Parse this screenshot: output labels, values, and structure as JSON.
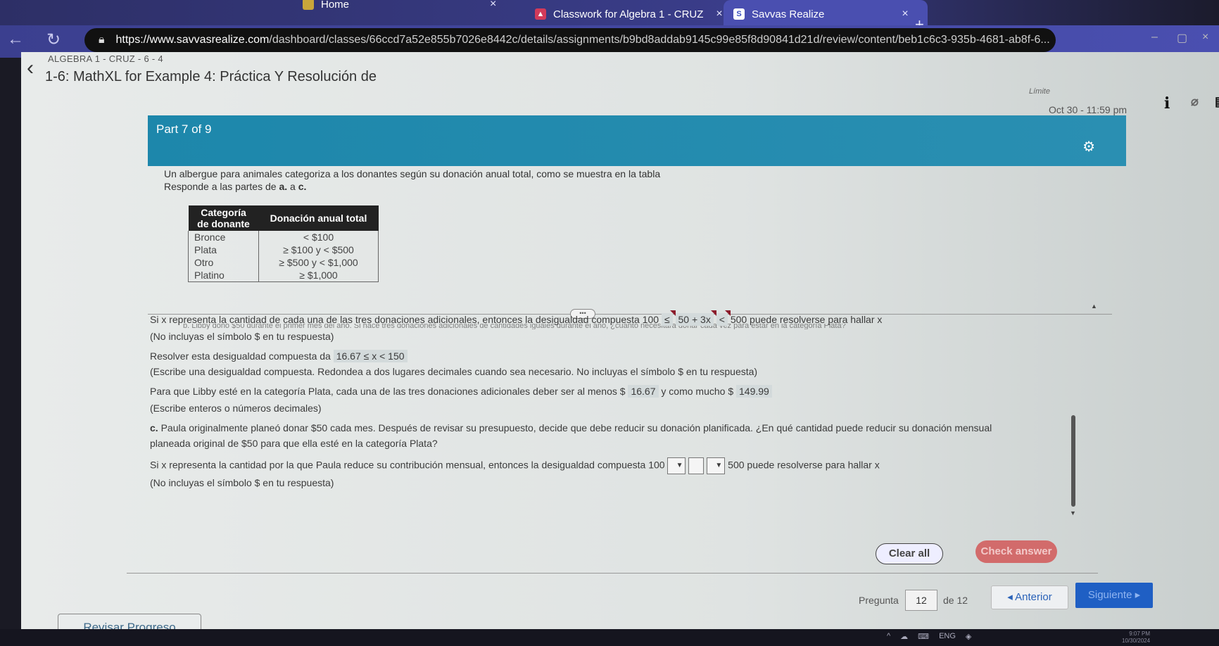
{
  "browser": {
    "tabs": [
      {
        "label": "Home",
        "icon": "home-tab-icon"
      },
      {
        "label": "Classwork for Algebra 1 - CRUZ",
        "icon": "classroom-icon"
      },
      {
        "label": "Savvas Realize",
        "icon": "savvas-icon",
        "active": true
      }
    ],
    "new_tab": "+",
    "close": "×",
    "url_host": "https://www.savvasrealize.com",
    "url_path": "/dashboard/classes/66ccd7a52e855b7026e8442c/details/assignments/b9bd8addab9145c99e85f8d90841d21d/review/content/beb1c6c3-935b-4681-ab8f-6...",
    "window_controls": {
      "minimize": "–",
      "restore": "▢",
      "close": "×"
    }
  },
  "header": {
    "breadcrumb": "ALGEBRA 1 - CRUZ - 6 - 4",
    "title": "1-6: MathXL for Example 4: Práctica Y Resolución de",
    "limit_label": "Límite",
    "limit_value": "Oct 30 - 11:59 pm",
    "icons": [
      "info-icon",
      "attachment-icon",
      "comment-icon"
    ]
  },
  "question": {
    "part_label": "Part 7 of 9",
    "intro_line1": "Un albergue para animales categoriza a los donantes según su donación anual total, como se muestra en la tabla",
    "intro_line2_prefix": "Responde a las partes de ",
    "intro_a": "a.",
    "intro_mid": " a ",
    "intro_c": "c.",
    "table": {
      "headers": [
        "Categoría de donante",
        "Donación anual total"
      ],
      "rows": [
        [
          "Bronce",
          "< $100"
        ],
        [
          "Plata",
          "≥ $100 y < $500"
        ],
        [
          "Otro",
          "≥ $500 y < $1,000"
        ],
        [
          "Platino",
          "≥ $1,000"
        ]
      ]
    },
    "handle": "•••",
    "cut_line": "b. Libby donó $50 durante el primer mes del año. Si hace tres donaciones adicionales de cantidades iguales durante el año, ¿cuánto necesitará donar cada vez para estar en la categoría Plata?",
    "b1_text": "Si x representa la cantidad de cada una de las tres donaciones adicionales, entonces la desigualdad compuesta 100",
    "b1_op1": "≤",
    "b1_expr": "50 + 3x",
    "b1_op2": "<",
    "b1_tail": "500 puede resolverse para hallar x",
    "b1_note": "(No incluyas el símbolo $ en tu respuesta)",
    "b2_text": "Resolver esta desigualdad compuesta da",
    "b2_answer": "16.67 ≤ x < 150",
    "b2_note": "(Escribe una desigualdad compuesta. Redondea a dos lugares decimales cuando sea necesario. No incluyas el símbolo $ en tu respuesta)",
    "b3_text": "Para que Libby esté en la categoría Plata, cada una de las tres donaciones adicionales deber ser al menos $",
    "b3_min": "16.67",
    "b3_mid": "y como mucho $",
    "b3_max": "149.99",
    "b3_note": "(Escribe enteros o números decimales)",
    "c_label": "c.",
    "c_text1": " Paula originalmente planeó donar $50 cada mes. Después de revisar su presupuesto, decide que debe reducir su donación planificada. ¿En qué cantidad puede reducir su donación mensual",
    "c_text2": "planeada original de $50 para que ella esté en la categoría Plata?",
    "c2_text": "Si x representa la cantidad por la que Paula reduce su contribución mensual, entonces la desigualdad compuesta 100",
    "c2_tail": "500 puede resolverse para hallar x",
    "c2_note": "(No incluyas el símbolo $ en tu respuesta)",
    "dropdown_arrow": "▼"
  },
  "actions": {
    "clear_all": "Clear all",
    "check_answer": "Check answer"
  },
  "pagination": {
    "label": "Pregunta",
    "current": "12",
    "of": "de 12",
    "prev": "◂ Anterior",
    "next": "Siguiente ▸"
  },
  "review_button": "Revisar Progreso",
  "taskbar": {
    "lang": "ENG",
    "time": "9:07 PM",
    "date": "10/30/2024"
  }
}
